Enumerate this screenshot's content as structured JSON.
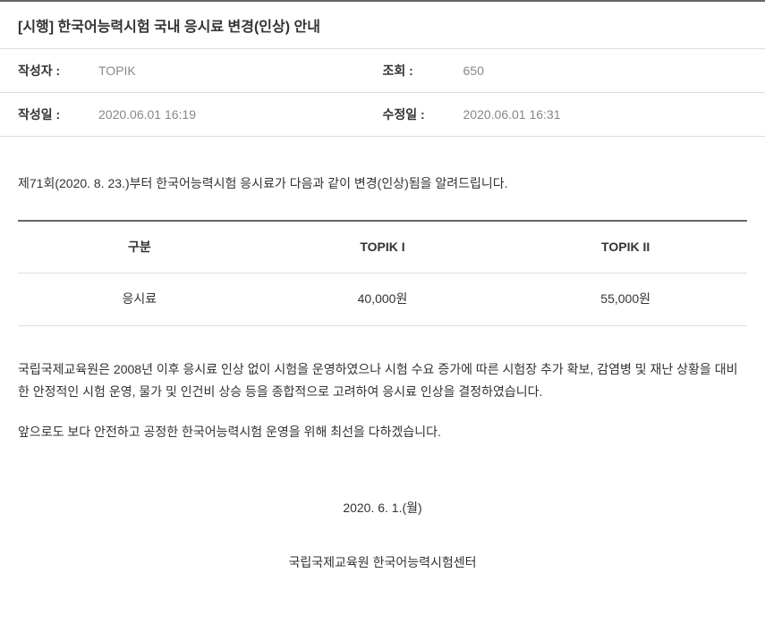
{
  "title": "[시행] 한국어능력시험 국내 응시료 변경(인상) 안내",
  "meta": {
    "author_label": "작성자 :",
    "author_value": "TOPIK",
    "views_label": "조회 :",
    "views_value": "650",
    "created_label": "작성일 :",
    "created_value": "2020.06.01 16:19",
    "modified_label": "수정일 :",
    "modified_value": "2020.06.01 16:31"
  },
  "body": {
    "intro": "제71회(2020. 8. 23.)부터 한국어능력시험 응시료가 다음과 같이 변경(인상)됨을 알려드립니다.",
    "table": {
      "headers": [
        "구분",
        "TOPIK I",
        "TOPIK II"
      ],
      "row_label": "응시료",
      "topik1_fee": "40,000원",
      "topik2_fee": "55,000원"
    },
    "para1": "국립국제교육원은 2008년 이후 응시료 인상 없이 시험을 운영하였으나 시험 수요 증가에 따른 시험장 추가 확보, 감염병 및 재난 상황을 대비한 안정적인 시험 운영, 물가 및 인건비 상승 등을 종합적으로 고려하여 응시료 인상을 결정하였습니다.",
    "para2": "앞으로도 보다 안전하고 공정한 한국어능력시험 운영을 위해 최선을 다하겠습니다.",
    "date": "2020. 6. 1.(월)",
    "signer": "국립국제교육원 한국어능력시험센터"
  }
}
